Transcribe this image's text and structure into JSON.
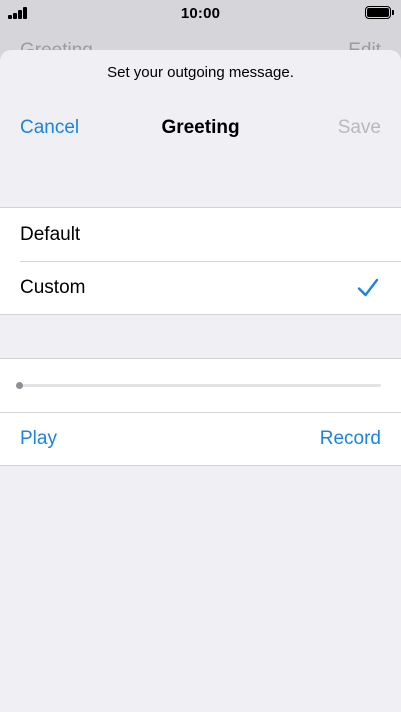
{
  "status_bar": {
    "time": "10:00",
    "signal_bars": 4,
    "battery_icon": "battery-full-icon"
  },
  "underlying_page": {
    "title": "Greeting",
    "edit_label": "Edit"
  },
  "sheet": {
    "prompt": "Set your outgoing message.",
    "nav": {
      "cancel_label": "Cancel",
      "title": "Greeting",
      "save_label": "Save"
    },
    "greeting_options": [
      {
        "label": "Default",
        "selected": false
      },
      {
        "label": "Custom",
        "selected": true
      }
    ],
    "player": {
      "progress": 0,
      "play_label": "Play",
      "record_label": "Record"
    }
  },
  "colors": {
    "accent": "#1a84e2",
    "disabled": "#b8b8bd",
    "sheet_background": "#efeff4",
    "cell_background": "#ffffff"
  }
}
